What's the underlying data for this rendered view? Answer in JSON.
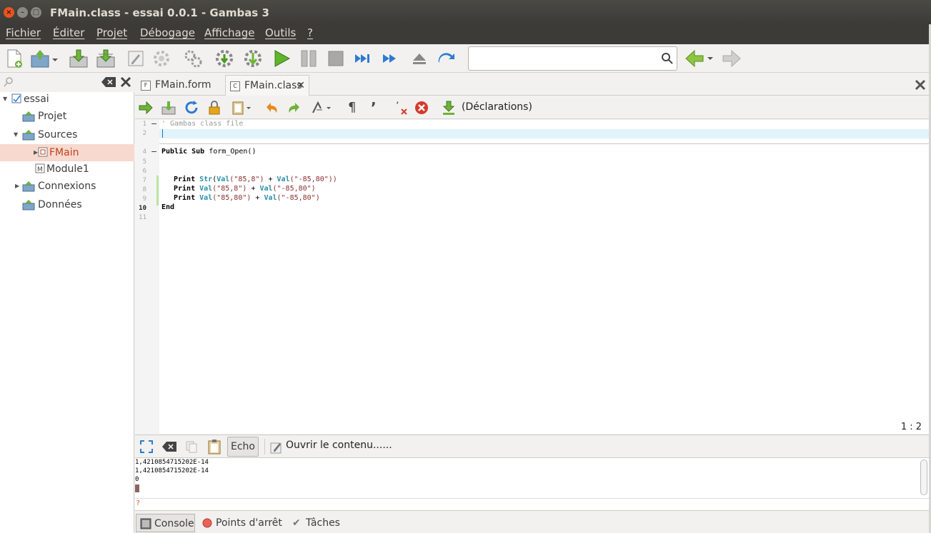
{
  "window": {
    "title": "FMain.class - essai 0.0.1 - Gambas 3",
    "close_glyph": "×",
    "min_glyph": "–",
    "max_glyph": "□"
  },
  "menu": [
    "Fichier",
    "Éditer",
    "Projet",
    "Débogage",
    "Affichage",
    "Outils",
    "?"
  ],
  "toolbar": {
    "search_value": ""
  },
  "project_tree": {
    "items": [
      {
        "label": "essai"
      },
      {
        "label": "Projet"
      },
      {
        "label": "Sources"
      },
      {
        "label": "FMain"
      },
      {
        "label": "Module1"
      },
      {
        "label": "Connexions"
      },
      {
        "label": "Données"
      }
    ]
  },
  "tabs": [
    {
      "label": "FMain.form",
      "icon": "F"
    },
    {
      "label": "FMain.class",
      "icon": "C"
    }
  ],
  "editor_toolbar": {
    "procedure_selector": "(Déclarations)"
  },
  "editor": {
    "line_numbers": [
      "1",
      "2",
      "4",
      "5",
      "6",
      "7",
      "8",
      "9",
      "10",
      "11"
    ],
    "comment_line": "' Gambas class file",
    "sub_decl_kw": "Public Sub",
    "sub_decl_name": "form_Open()",
    "line7": {
      "kw": "Print",
      "f1": "Str",
      "p1": "(",
      "f2": "Val",
      "s1": "(\"85,8\")",
      "op": " + ",
      "f3": "Val",
      "s2": "(\"-85,80\"))"
    },
    "line8": {
      "kw": "Print",
      "f1": "Val",
      "s1": "(\"85,8\")",
      "op": " + ",
      "f2": "Val",
      "s2": "(\"-85,80\")"
    },
    "line9": {
      "kw": "Print",
      "f1": "Val",
      "s1": "(\"85,80\")",
      "op": " + ",
      "f2": "Val",
      "s2": "(\"-85,80\")"
    },
    "end_kw": "End",
    "position": "1 : 2"
  },
  "console_toolbar": {
    "echo_label": "Echo",
    "open_label": "Ouvrir le contenu......"
  },
  "console": {
    "lines": [
      "1,4210854715202E-14",
      "1,4210854715202E-14",
      "0"
    ],
    "prompt": "?"
  },
  "bottom_tabs": [
    {
      "label": "Console"
    },
    {
      "label": "Points d'arrêt"
    },
    {
      "label": "Tâches"
    }
  ],
  "colors": {
    "titlebar": "#3c3b37",
    "selection": "#f7d9cf",
    "close_button": "#e95420",
    "keyword_fn": "#2b8fa8",
    "string": "#8a2f2f"
  }
}
